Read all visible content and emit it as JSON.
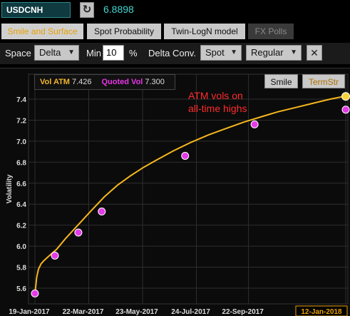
{
  "header": {
    "ticker": "USDCNH",
    "refresh_icon": "refresh-icon",
    "refresh_glyph": "↻",
    "price": "6.8898"
  },
  "tabs": [
    {
      "label": "Smile and Surface",
      "state": "active"
    },
    {
      "label": "Spot Probability",
      "state": "normal"
    },
    {
      "label": "Twin-LogN model",
      "state": "normal"
    },
    {
      "label": "FX Polls",
      "state": "disabled"
    }
  ],
  "controls": {
    "space_label": "Space",
    "space_value": "Delta",
    "min_label": "Min",
    "min_value": "10",
    "min_unit": "%",
    "delta_conv_label": "Delta Conv.",
    "delta_conv_value": "Spot",
    "regular_value": "Regular",
    "close_glyph": "✕"
  },
  "legend": {
    "atm_label": "Vol ATM",
    "atm_value": "7.426",
    "quoted_label": "Quoted Vol",
    "quoted_value": "7.300"
  },
  "view_buttons": {
    "smile": "Smile",
    "termstr": "TermStr"
  },
  "annotation_lines": [
    "ATM vols on",
    "all-time highs"
  ],
  "colors": {
    "curve": "#f5b61e",
    "quoted_point": "#e43ae8",
    "grid": "#2e2e2e",
    "annotation": "#ff2b2b"
  },
  "chart_data": {
    "type": "line",
    "ylabel": "Volatility",
    "xlabel": "",
    "ylim": [
      5.5,
      7.5
    ],
    "yticks": [
      "5.6",
      "5.8",
      "6.0",
      "6.2",
      "6.4",
      "6.6",
      "6.8",
      "7.0",
      "7.2",
      "7.4"
    ],
    "xticks": [
      "19-Jan-2017",
      "22-Mar-2017",
      "23-May-2017",
      "24-Jul-2017",
      "22-Sep-2017",
      "12-Jan-2018"
    ],
    "x_tick_days": [
      0,
      62,
      124,
      186,
      246,
      358
    ],
    "highlighted_xtick": "12-Jan-2018",
    "grid": true,
    "series": [
      {
        "kind": "line",
        "x_days": [
          0,
          1,
          2,
          4,
          7,
          10,
          14,
          18,
          25,
          35,
          45,
          55,
          65,
          80,
          95,
          110,
          125,
          140,
          160,
          180,
          200,
          220,
          240,
          260,
          280,
          300,
          320,
          340,
          358
        ],
        "values": [
          5.55,
          5.62,
          5.7,
          5.78,
          5.83,
          5.86,
          5.89,
          5.92,
          5.97,
          6.07,
          6.16,
          6.25,
          6.34,
          6.47,
          6.58,
          6.67,
          6.75,
          6.82,
          6.91,
          6.99,
          7.06,
          7.12,
          7.18,
          7.23,
          7.28,
          7.32,
          7.36,
          7.4,
          7.43
        ]
      },
      {
        "kind": "scatter",
        "x_days": [
          0,
          23,
          50,
          77,
          173,
          253,
          358
        ],
        "values": [
          5.55,
          5.91,
          6.13,
          6.33,
          6.86,
          7.16,
          7.3
        ]
      }
    ],
    "end_point": {
      "x_day": 358,
      "value": 7.426
    }
  }
}
